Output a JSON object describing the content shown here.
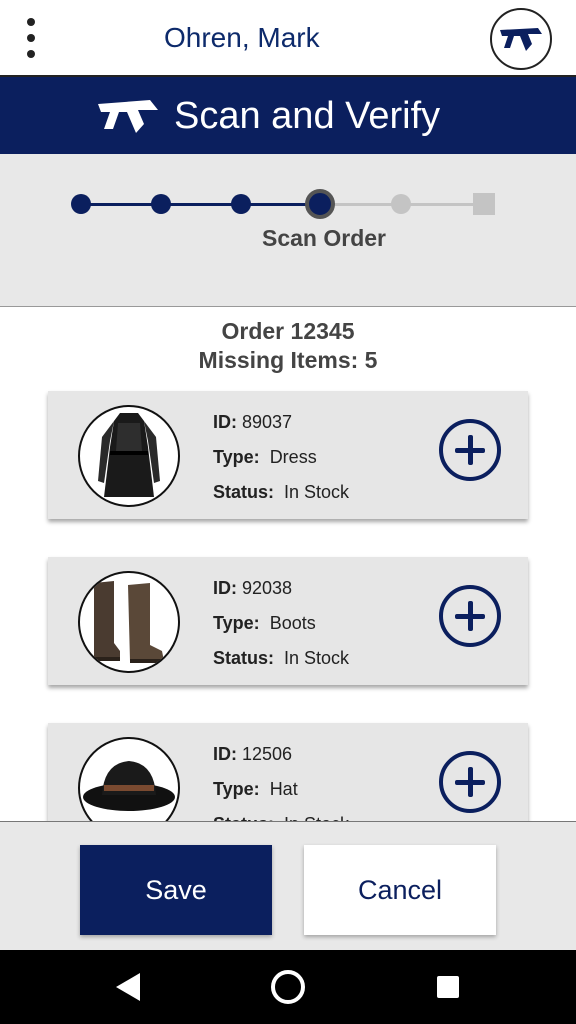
{
  "header": {
    "user_name": "Ohren, Mark",
    "menu_icon": "kebab-menu-icon",
    "avatar_icon": "company-logo-icon"
  },
  "banner": {
    "title": "Scan and Verify",
    "logo_icon": "company-logo-icon"
  },
  "stepper": {
    "current_step_label": "Scan Order",
    "total_steps": 6,
    "current_step_index": 4
  },
  "order": {
    "title": "Order 12345",
    "missing": "Missing Items: 5"
  },
  "items": [
    {
      "id_label": "ID:",
      "id": "89037",
      "type_label": "Type:",
      "type": "Dress",
      "status_label": "Status:",
      "status": "In Stock",
      "image": "dress-image"
    },
    {
      "id_label": "ID:",
      "id": "92038",
      "type_label": "Type:",
      "type": "Boots",
      "status_label": "Status:",
      "status": "In Stock",
      "image": "boots-image"
    },
    {
      "id_label": "ID:",
      "id": "12506",
      "type_label": "Type:",
      "type": "Hat",
      "status_label": "Status:",
      "status": "In Stock",
      "image": "hat-image"
    }
  ],
  "footer": {
    "save_label": "Save",
    "cancel_label": "Cancel"
  },
  "colors": {
    "brand_navy": "#0b1f5e",
    "panel_gray": "#e8e8e8"
  }
}
